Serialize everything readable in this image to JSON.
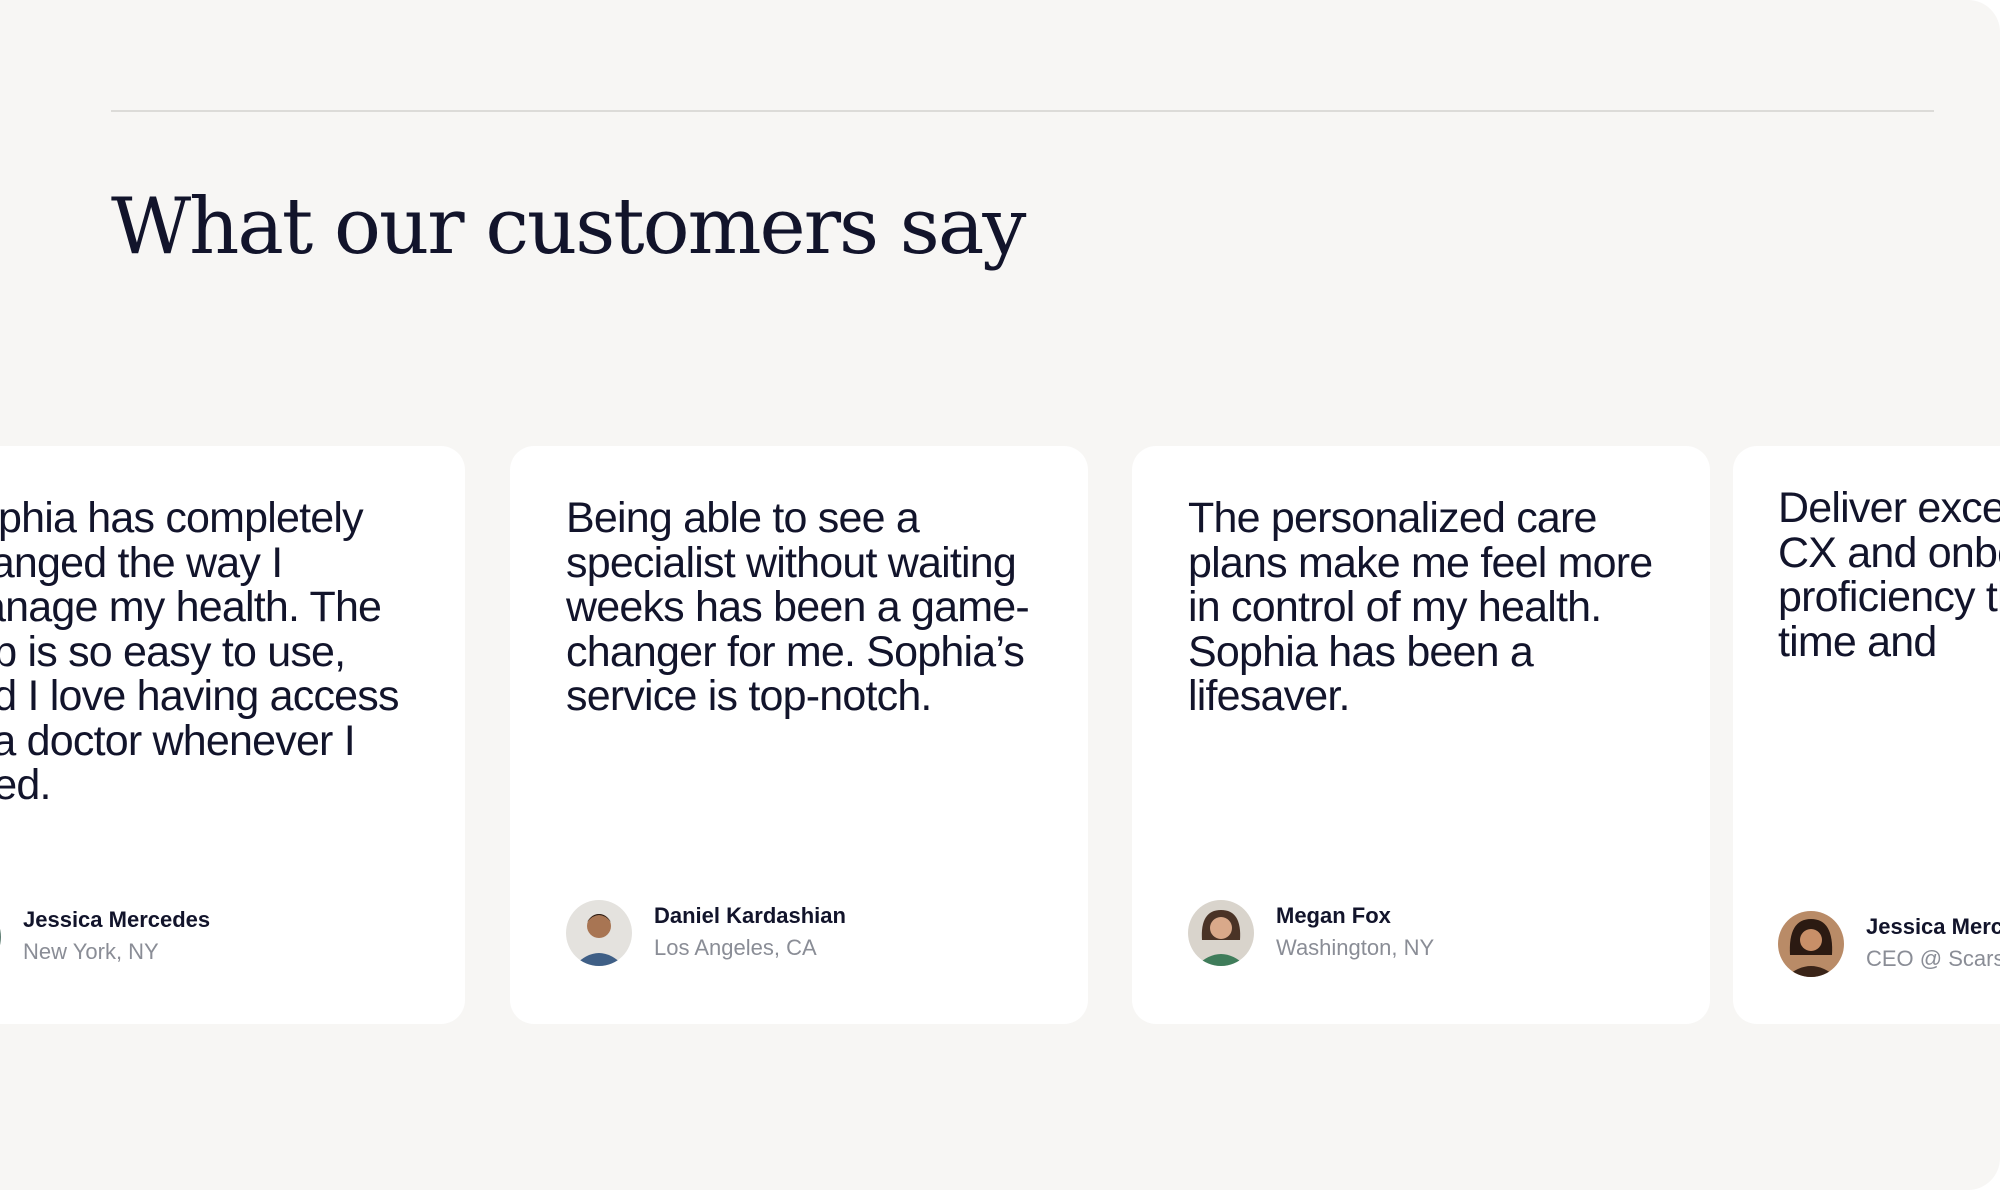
{
  "section": {
    "title": "What our customers say"
  },
  "testimonials": [
    {
      "quote": "Sophia has completely changed the way I manage my health. The app is so easy to use, and I love having access to a doctor whenever I need.",
      "name": "Jessica Mercedes",
      "location": "New York, NY",
      "avatar_icon": "avatar-photo"
    },
    {
      "quote": "Being able to see a specialist without waiting weeks has been a game-changer for me. Sophia’s service is top-notch.",
      "name": "Daniel Kardashian",
      "location": "Los Angeles, CA",
      "avatar_icon": "avatar-photo"
    },
    {
      "quote": "The personalized care plans make me feel more in control of my health. Sophia has been a lifesaver.",
      "name": "Megan Fox",
      "location": "Washington, NY",
      "avatar_icon": "avatar-photo"
    },
    {
      "quote": "Deliver exceptional quality CX and onboard with new proficiency that saves you time and",
      "name": "Jessica Mercedes",
      "location": "CEO @ Scarsdale",
      "avatar_icon": "avatar-photo"
    }
  ],
  "colors": {
    "background": "#f7f6f4",
    "card": "#ffffff",
    "text": "#12142b",
    "muted": "#8a8d96"
  }
}
